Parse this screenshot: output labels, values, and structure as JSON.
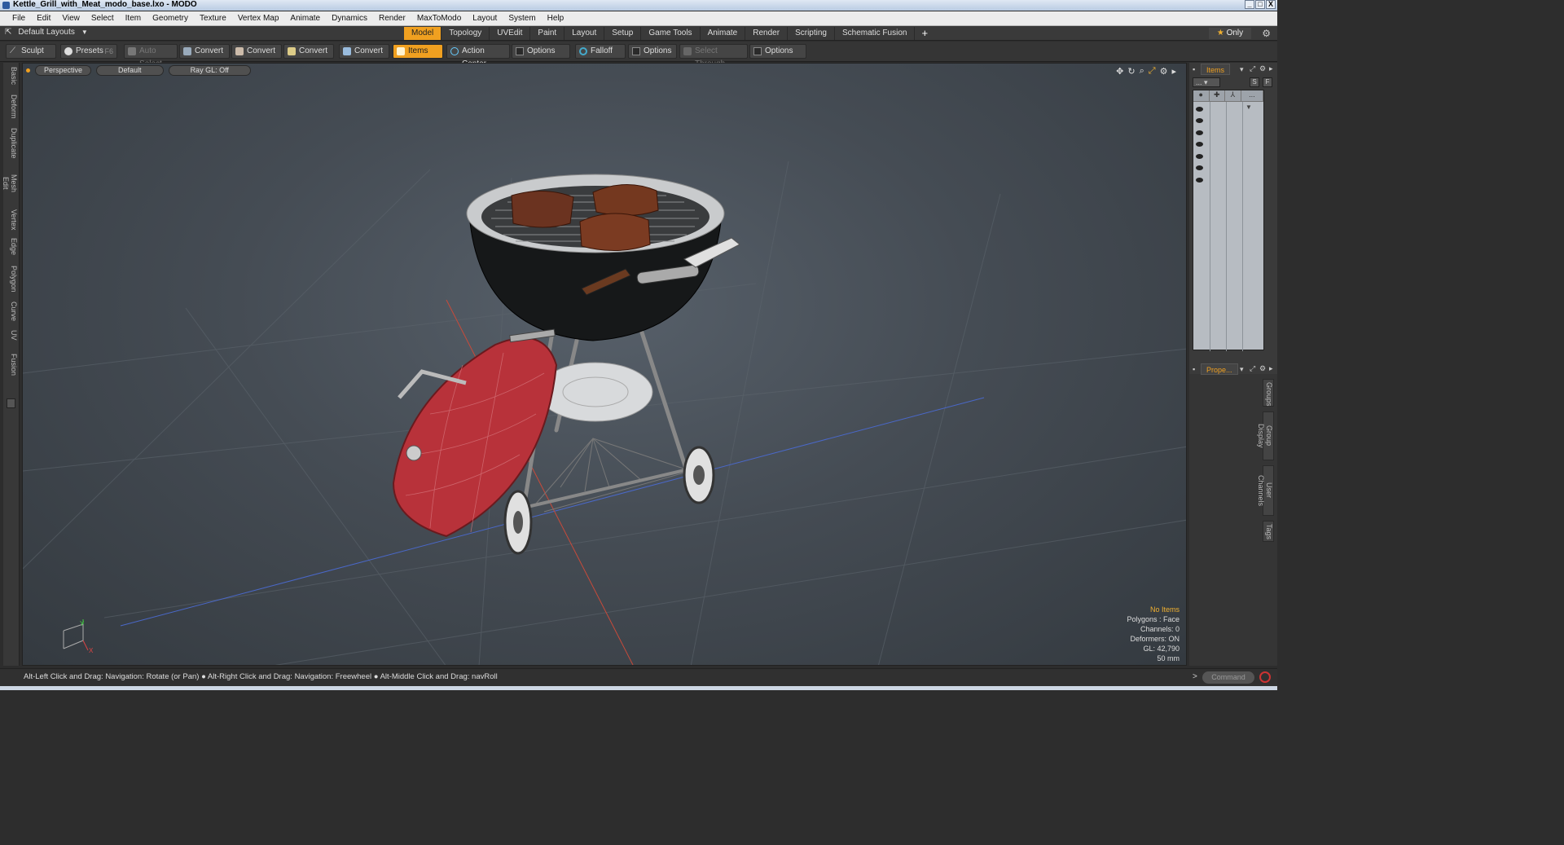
{
  "window": {
    "title": "Kettle_Grill_with_Meat_modo_base.lxo - MODO",
    "controls": [
      "_",
      "□",
      "X"
    ]
  },
  "menu": [
    "File",
    "Edit",
    "View",
    "Select",
    "Item",
    "Geometry",
    "Texture",
    "Vertex Map",
    "Animate",
    "Dynamics",
    "Render",
    "MaxToModo",
    "Layout",
    "System",
    "Help"
  ],
  "layouts": {
    "label": "Default Layouts"
  },
  "tabs": [
    "Model",
    "Topology",
    "UVEdit",
    "Paint",
    "Layout",
    "Setup",
    "Game Tools",
    "Animate",
    "Render",
    "Scripting",
    "Schematic Fusion"
  ],
  "active_tab": "Model",
  "only_button": "Only",
  "toolbar": {
    "sculpt": "Sculpt",
    "presets": "Presets",
    "presets_key": "F6",
    "auto_select": "Auto Select",
    "convert": "Convert",
    "items": "Items",
    "action_center": "Action Center",
    "options": "Options",
    "falloff": "Falloff",
    "select_through": "Select Through"
  },
  "left_tabs": [
    "Basic",
    "Deform",
    "Duplicate",
    "Mesh Edit",
    "Vertex",
    "Edge",
    "Polygon",
    "Curve",
    "UV",
    "Fusion"
  ],
  "viewport": {
    "view": "Perspective",
    "shading": "Default",
    "raygl": "Ray GL: Off",
    "info": {
      "items": "No Items",
      "polygons": "Polygons : Face",
      "channels": "Channels: 0",
      "deformers": "Deformers: ON",
      "gl": "GL: 42,790",
      "focal": "50 mm"
    },
    "axis_y": "Y",
    "axis_x": "X"
  },
  "right_panel": {
    "items_tab": "Items",
    "props_tab": "Prope...",
    "s_btn": "S",
    "f_btn": "F",
    "dots": "...",
    "side_tabs": [
      "Groups",
      "Group Display",
      "User Channels",
      "Tags"
    ]
  },
  "status": {
    "hint": "Alt-Left Click and Drag: Navigation: Rotate (or Pan) ● Alt-Right Click and Drag: Navigation: Freewheel ● Alt-Middle Click and Drag: navRoll",
    "command_placeholder": "Command"
  },
  "colors": {
    "accent": "#f0a020",
    "viewport_bg": "#4a5058",
    "lid_red": "#c8343c"
  }
}
